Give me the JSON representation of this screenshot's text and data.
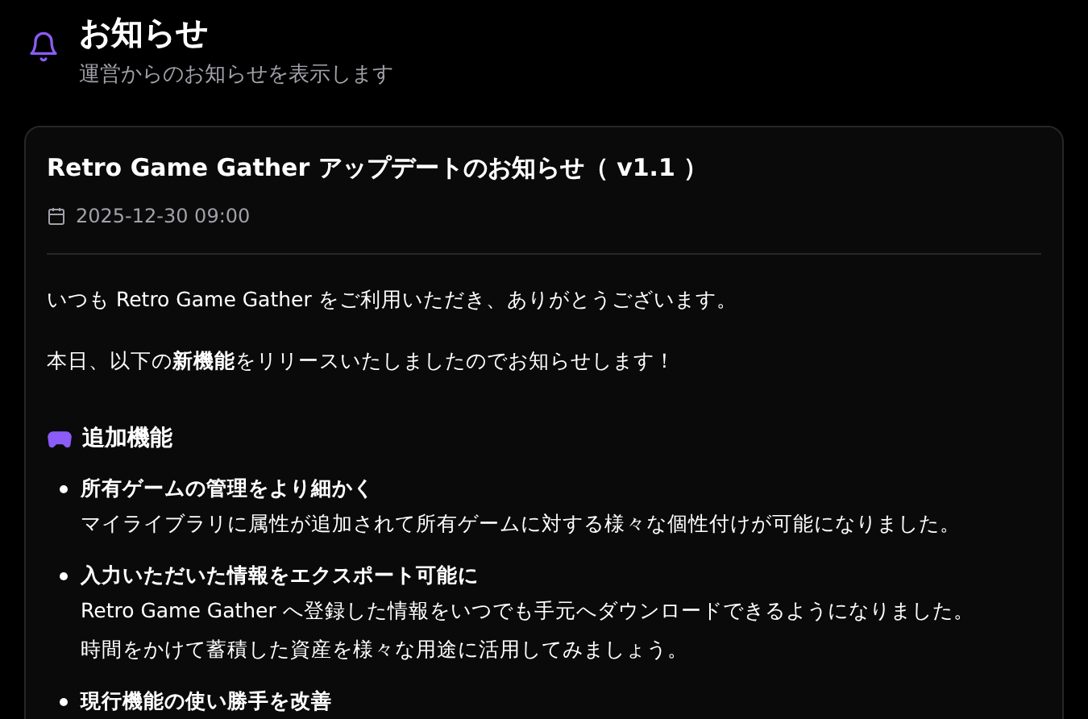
{
  "header": {
    "title": "お知らせ",
    "subtitle": "運営からのお知らせを表示します"
  },
  "notice": {
    "title": "Retro Game Gather アップデートのお知らせ（ v1.1 ）",
    "date": "2025-12-30 09:00",
    "paragraphs": [
      "いつも Retro Game Gather をご利用いただき、ありがとうございます。",
      "本日、以下の**新機能**をリリースいたしましたのでお知らせします！"
    ],
    "section": {
      "title": "追加機能",
      "items": [
        {
          "title": "所有ゲームの管理をより細かく",
          "lines": [
            "マイライブラリに属性が追加されて所有ゲームに対する様々な個性付けが可能になりました。"
          ]
        },
        {
          "title": "入力いただいた情報をエクスポート可能に",
          "lines": [
            "Retro Game Gather へ登録した情報をいつでも手元へダウンロードできるようになりました。",
            "時間をかけて蓄積した資産を様々な用途に活用してみましょう。"
          ]
        },
        {
          "title": "現行機能の使い勝手を改善"
        }
      ]
    }
  }
}
